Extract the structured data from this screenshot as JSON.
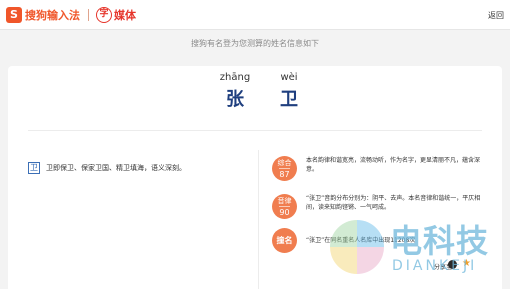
{
  "header": {
    "logo_icon": "S",
    "logo_text": "搜狗输入法",
    "brand2_icon": "字",
    "brand2_text": "媒体",
    "back_label": "返回"
  },
  "subtitle": "搜狗有名登为您测算的姓名信息如下",
  "name": {
    "chars": [
      {
        "pinyin": "zhāng",
        "hanzi": "张"
      },
      {
        "pinyin": "wèi",
        "hanzi": "卫"
      }
    ]
  },
  "meaning": {
    "tag": "卫",
    "text": "卫即保卫、保家卫国、精卫填海，语义深刻。"
  },
  "items": [
    {
      "label": "综合",
      "value": "87",
      "text": "本名韵律和谐宽亮，流畅动听，作为名字，更显清丽不凡，蕴含深意。"
    },
    {
      "label": "音律",
      "value": "90",
      "text": "“张卫”音韵分布分别为：阴平、去声。本名音律和谐统一，平仄相间，读来知韵铿锵、一气呵成。"
    },
    {
      "label": "撞名",
      "value": "",
      "text": "“张卫”在同名重名人名库中出现11208次"
    }
  ],
  "share_label": "分享至",
  "watermark": {
    "title": "电科技",
    "sub": "DIANKEJI"
  },
  "colors": {
    "accent": "#f0562a",
    "badge": "#f07d4f",
    "name": "#1f3f7f"
  }
}
